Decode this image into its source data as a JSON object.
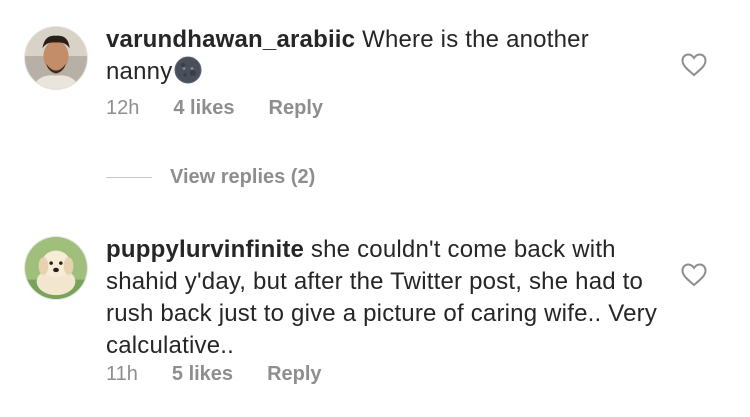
{
  "comments": [
    {
      "username": "varundhawan_arabiic",
      "text": " Where is the another nanny",
      "emoji": "new-moon-face-emoji",
      "time": "12h",
      "likes": "4 likes",
      "reply": "Reply",
      "avatar": "user-avatar-photo"
    },
    {
      "username": "puppylurvinfinite",
      "text": " she couldn't come back with shahid y'day, but after the Twitter post, she had to rush back just to give a picture of caring wife.. Very calculative..",
      "time": "11h",
      "likes": "5 likes",
      "reply": "Reply",
      "avatar": "puppy-avatar-photo"
    }
  ],
  "view_replies": {
    "label": "View replies (2)"
  },
  "colors": {
    "primary_text": "#262626",
    "secondary_text": "#8e8e8e",
    "divider": "#c7c7c7"
  },
  "icons": {
    "like": "heart-outline-icon"
  }
}
